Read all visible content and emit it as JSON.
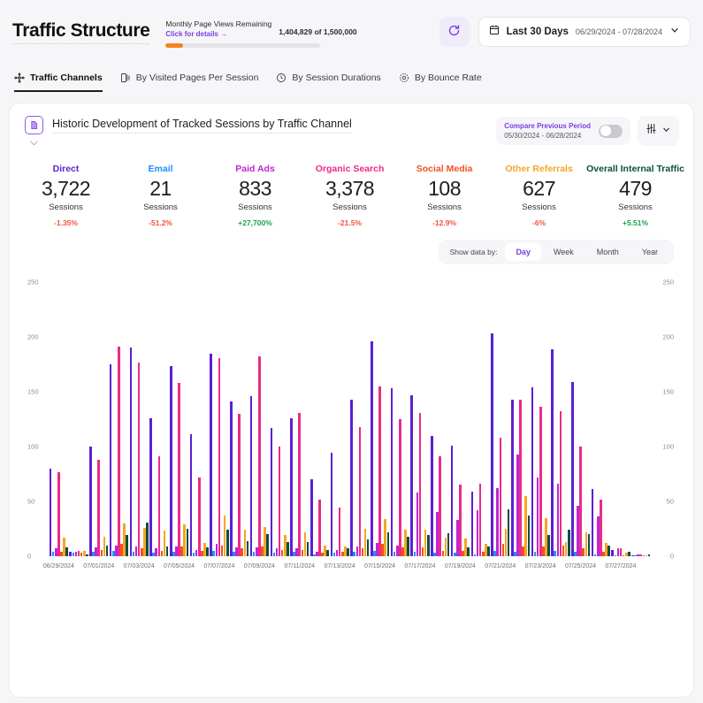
{
  "header": {
    "title": "Traffic Structure",
    "quota_label": "Monthly Page Views Remaining",
    "quota_link": "Click for details →",
    "quota_count": "1,404,829 of 1,500,000",
    "refresh_icon": "refresh-icon",
    "calendar_icon": "calendar-icon",
    "date_preset": "Last 30 Days",
    "date_range": "06/29/2024 - 07/28/2024",
    "chevron_icon": "chevron-down-icon"
  },
  "tabs": [
    {
      "label": "Traffic Channels",
      "icon": "network-nodes-icon",
      "active": true
    },
    {
      "label": "By Visited Pages Per Session",
      "icon": "pages-icon",
      "active": false
    },
    {
      "label": "By Session Durations",
      "icon": "clock-icon",
      "active": false
    },
    {
      "label": "By Bounce Rate",
      "icon": "target-icon",
      "active": false
    }
  ],
  "card": {
    "icon": "report-icon",
    "title": "Historic Development of Tracked Sessions by Traffic Channel",
    "compare_label": "Compare Previous Period",
    "compare_dates": "05/30/2024 - 06/28/2024",
    "toggle_state": "off",
    "settings_icon": "sliders-icon",
    "settings_chevron": "chevron-down-icon"
  },
  "kpis": [
    {
      "name": "Direct",
      "value": "3,722",
      "unit": "Sessions",
      "delta": "-1.35%",
      "color": "#5b1fd4",
      "delta_color": "#f0533b"
    },
    {
      "name": "Email",
      "value": "21",
      "unit": "Sessions",
      "delta": "-51.2%",
      "color": "#1e90ff",
      "delta_color": "#f0533b"
    },
    {
      "name": "Paid Ads",
      "value": "833",
      "unit": "Sessions",
      "delta": "+27,700%",
      "color": "#c026d3",
      "delta_color": "#16a34a"
    },
    {
      "name": "Organic Search",
      "value": "3,378",
      "unit": "Sessions",
      "delta": "-21.5%",
      "color": "#ec2a8b",
      "delta_color": "#f0533b"
    },
    {
      "name": "Social Media",
      "value": "108",
      "unit": "Sessions",
      "delta": "-12.9%",
      "color": "#f4511e",
      "delta_color": "#f0533b"
    },
    {
      "name": "Other Referrals",
      "value": "627",
      "unit": "Sessions",
      "delta": "-6%",
      "color": "#f5a623",
      "delta_color": "#f0533b"
    },
    {
      "name": "Overall Internal Traffic",
      "value": "479",
      "unit": "Sessions",
      "delta": "+5.51%",
      "color": "#0b4f3f",
      "delta_color": "#16a34a"
    }
  ],
  "granularity": {
    "label": "Show data by:",
    "options": [
      "Day",
      "Week",
      "Month",
      "Year"
    ],
    "selected": "Day"
  },
  "chart_data": {
    "type": "bar",
    "title": "Historic Development of Tracked Sessions by Traffic Channel",
    "xlabel": "",
    "ylabel": "Sessions",
    "ylim": [
      0,
      250
    ],
    "yticks": [
      0,
      50,
      100,
      150,
      200,
      250
    ],
    "grid": false,
    "legend_position": "top",
    "dual_axis": true,
    "categories": [
      "06/29/2024",
      "06/30/2024",
      "07/01/2024",
      "07/02/2024",
      "07/03/2024",
      "07/04/2024",
      "07/05/2024",
      "07/06/2024",
      "07/07/2024",
      "07/08/2024",
      "07/09/2024",
      "07/10/2024",
      "07/11/2024",
      "07/12/2024",
      "07/13/2024",
      "07/14/2024",
      "07/15/2024",
      "07/16/2024",
      "07/17/2024",
      "07/18/2024",
      "07/19/2024",
      "07/20/2024",
      "07/21/2024",
      "07/22/2024",
      "07/23/2024",
      "07/24/2024",
      "07/25/2024",
      "07/26/2024",
      "07/27/2024",
      "07/28/2024"
    ],
    "xtick_labels": [
      "06/29/2024",
      "07/01/2024",
      "07/03/2024",
      "07/05/2024",
      "07/07/2024",
      "07/09/2024",
      "07/11/2024",
      "07/13/2024",
      "07/15/2024",
      "07/17/2024",
      "07/19/2024",
      "07/21/2024",
      "07/23/2024",
      "07/25/2024",
      "07/27/2024"
    ],
    "series": [
      {
        "name": "Direct",
        "color": "#5b1fd4",
        "values": [
          80,
          4,
          100,
          175,
          190,
          126,
          173,
          111,
          185,
          141,
          146,
          117,
          126,
          70,
          94,
          143,
          196,
          153,
          147,
          110,
          101,
          59,
          203,
          143,
          154,
          189,
          159,
          61,
          6,
          1
        ]
      },
      {
        "name": "Email",
        "color": "#1e90ff",
        "values": [
          4,
          3,
          4,
          5,
          4,
          3,
          4,
          3,
          5,
          4,
          4,
          3,
          4,
          2,
          3,
          4,
          5,
          4,
          4,
          3,
          3,
          2,
          5,
          4,
          4,
          5,
          4,
          2,
          1,
          0
        ]
      },
      {
        "name": "Paid Ads",
        "color": "#c026d3",
        "values": [
          7,
          4,
          8,
          10,
          9,
          7,
          9,
          6,
          11,
          8,
          8,
          7,
          7,
          4,
          6,
          9,
          12,
          10,
          58,
          40,
          33,
          42,
          62,
          93,
          72,
          66,
          46,
          36,
          7,
          2
        ]
      },
      {
        "name": "Organic Search",
        "color": "#ec2a8b",
        "values": [
          77,
          5,
          88,
          191,
          177,
          91,
          158,
          72,
          181,
          130,
          182,
          100,
          131,
          52,
          44,
          118,
          155,
          125,
          131,
          91,
          65,
          66,
          108,
          143,
          136,
          132,
          100,
          52,
          7,
          2
        ]
      },
      {
        "name": "Social Media",
        "color": "#f4511e",
        "values": [
          4,
          3,
          6,
          11,
          7,
          5,
          9,
          5,
          10,
          7,
          9,
          6,
          6,
          3,
          4,
          7,
          11,
          8,
          8,
          5,
          5,
          4,
          11,
          9,
          9,
          10,
          7,
          4,
          1,
          0
        ]
      },
      {
        "name": "Other Referrals",
        "color": "#f5a623",
        "values": [
          17,
          5,
          18,
          30,
          26,
          23,
          29,
          12,
          37,
          24,
          27,
          19,
          22,
          10,
          9,
          25,
          34,
          24,
          24,
          17,
          16,
          11,
          25,
          55,
          35,
          13,
          22,
          12,
          3,
          1
        ]
      },
      {
        "name": "Overall Internal Traffic",
        "color": "#0b4f3f",
        "values": [
          8,
          2,
          10,
          19,
          31,
          9,
          25,
          8,
          24,
          14,
          20,
          13,
          13,
          6,
          7,
          15,
          22,
          18,
          19,
          21,
          8,
          9,
          43,
          37,
          19,
          24,
          20,
          10,
          4,
          2
        ]
      }
    ]
  }
}
